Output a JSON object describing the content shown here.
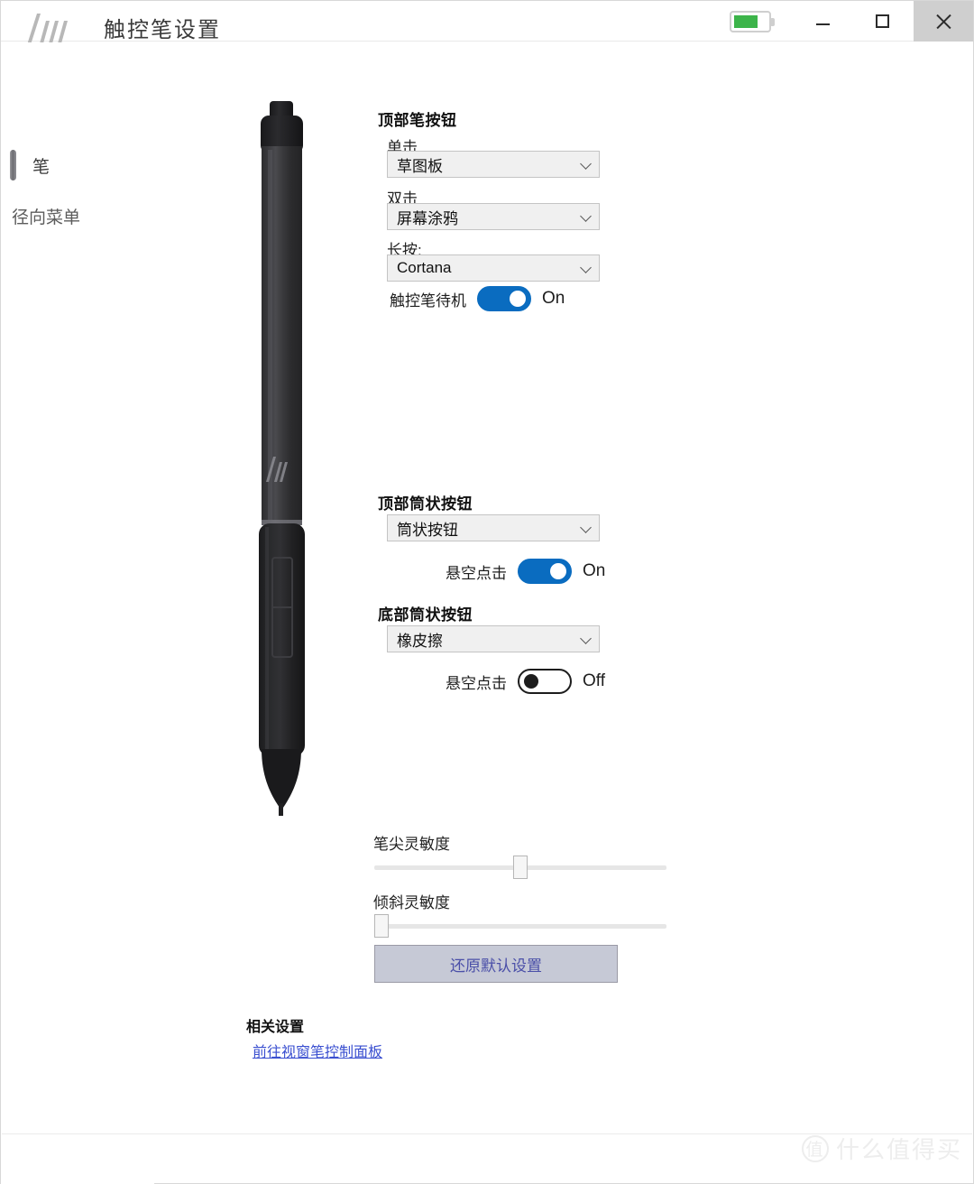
{
  "window": {
    "title": "触控笔设置",
    "logo_name": "hp-logo",
    "battery": {
      "icon": "battery-icon",
      "level_percent": 62,
      "color": "#3cb44a"
    },
    "controls": {
      "minimize": "minimize-icon",
      "maximize": "maximize-icon",
      "close": "close-icon"
    }
  },
  "sidebar": {
    "items": [
      {
        "label": "笔",
        "icon": "pen-icon",
        "selected": true
      },
      {
        "label": "径向菜单",
        "icon": "",
        "selected": false
      }
    ]
  },
  "illustration": {
    "name": "hp-pen-illustration",
    "brand_mark": "hp"
  },
  "sections": {
    "top_pen_button": {
      "title": "顶部笔按钮",
      "fields": [
        {
          "label": "单击",
          "value": "草图板"
        },
        {
          "label": "双击",
          "value": "屏幕涂鸦"
        },
        {
          "label": "长按:",
          "value": "Cortana"
        }
      ],
      "toggle": {
        "label": "触控笔待机",
        "state": "On",
        "on": true
      }
    },
    "top_barrel_button": {
      "title": "顶部筒状按钮",
      "value": "筒状按钮",
      "toggle": {
        "label": "悬空点击",
        "state": "On",
        "on": true
      }
    },
    "bottom_barrel_button": {
      "title": "底部筒状按钮",
      "value": "橡皮擦",
      "toggle": {
        "label": "悬空点击",
        "state": "Off",
        "on": false
      }
    }
  },
  "sliders": [
    {
      "label": "笔尖灵敏度",
      "value_percent": 50
    },
    {
      "label": "倾斜灵敏度",
      "value_percent": 0
    }
  ],
  "reset_button": {
    "label": "还原默认设置"
  },
  "related": {
    "title": "相关设置",
    "link": "前往视窗笔控制面板"
  },
  "watermark": {
    "mark": "值",
    "text": "什么值得买"
  },
  "colors": {
    "accent_blue": "#0a6cc0",
    "link_blue": "#3a4fd0",
    "battery_green": "#3cb44a",
    "button_bg": "#c6c9d6"
  }
}
